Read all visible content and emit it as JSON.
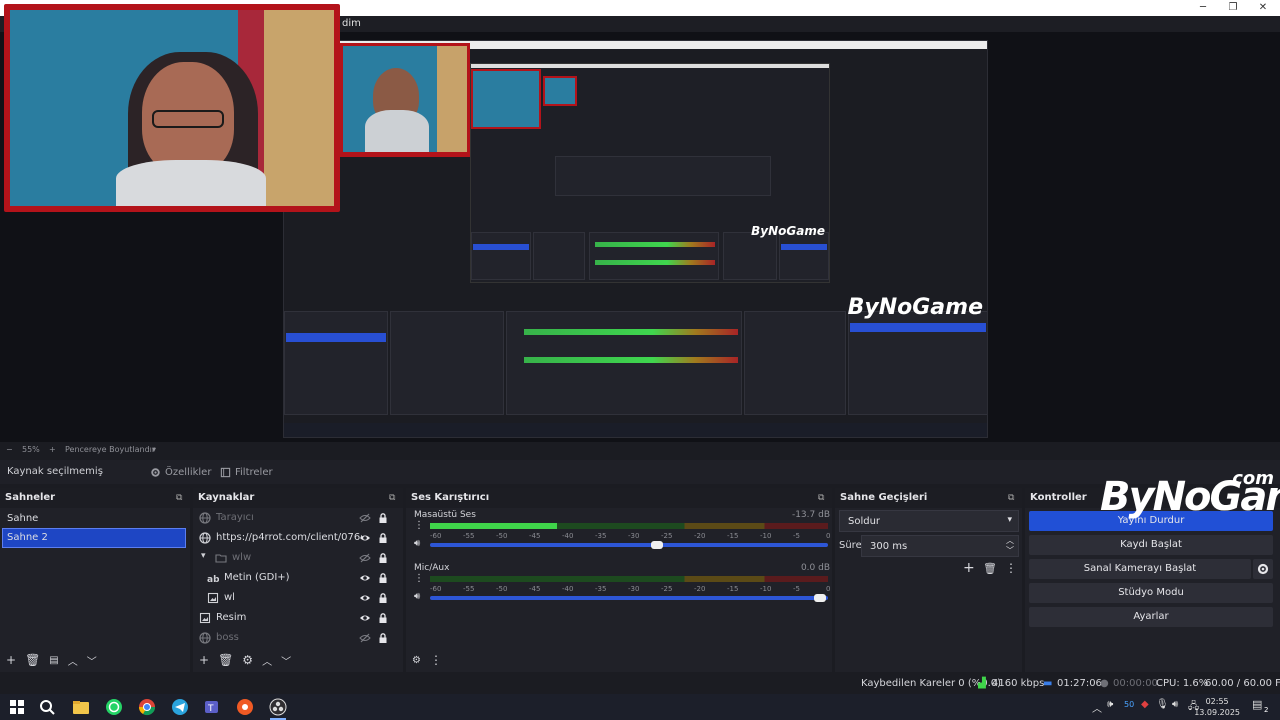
{
  "window": {
    "title_fragment": "dim"
  },
  "zoom": {
    "minus": "−",
    "level": "55%",
    "plus": "+",
    "fit": "Pencereye Boyutlandır"
  },
  "source_toolbar": {
    "no_source": "Kaynak seçilmemiş",
    "properties": "Özellikler",
    "filters": "Filtreler"
  },
  "scenes": {
    "title": "Sahneler",
    "items": [
      {
        "label": "Sahne",
        "selected": false
      },
      {
        "label": "Sahne 2",
        "selected": true
      }
    ]
  },
  "sources": {
    "title": "Kaynaklar",
    "items": [
      {
        "label": "Tarayıcı",
        "icon": "globe-icon",
        "visible": false,
        "dim": true,
        "indent": 0
      },
      {
        "label": "https://p4rrot.com/client/076e7cf1-",
        "icon": "globe-icon",
        "visible": true,
        "dim": false,
        "indent": 0
      },
      {
        "label": "wlw",
        "icon": "folder-icon",
        "visible": false,
        "dim": true,
        "indent": 1
      },
      {
        "label": "Metin (GDI+)",
        "icon": "text-icon",
        "visible": true,
        "dim": false,
        "indent": 2
      },
      {
        "label": "wl",
        "icon": "image-icon",
        "visible": true,
        "dim": false,
        "indent": 2
      },
      {
        "label": "Resim",
        "icon": "image-icon",
        "visible": true,
        "dim": false,
        "indent": 0
      },
      {
        "label": "boss",
        "icon": "globe-icon",
        "visible": false,
        "dim": true,
        "indent": 0
      }
    ]
  },
  "mixer": {
    "title": "Ses Karıştırıcı",
    "ticks": [
      "-60",
      "-55",
      "-50",
      "-45",
      "-40",
      "-35",
      "-30",
      "-25",
      "-20",
      "-15",
      "-10",
      "-5",
      "0"
    ],
    "channels": [
      {
        "name": "Masaüstü Ses",
        "db": "-13.7 dB",
        "level": 0.32,
        "volume": 0.57
      },
      {
        "name": "Mic/Aux",
        "db": "0.0 dB",
        "level": 0.0,
        "volume": 0.98
      }
    ]
  },
  "transitions": {
    "title": "Sahne Geçişleri",
    "selected": "Soldur",
    "duration_label": "Süre",
    "duration_value": "300 ms"
  },
  "controls": {
    "title": "Kontroller",
    "buttons": [
      "Yayını Durdur",
      "Kaydı Başlat",
      "Sanal Kamerayı Başlat",
      "Stüdyo Modu",
      "Ayarlar"
    ]
  },
  "status": {
    "dropped": "Kaybedilen Kareler 0 (%0.0)",
    "bitrate": "4160 kbps",
    "stream_time": "01:27:06",
    "rec_time": "00:00:00",
    "cpu": "CPU: 1.6%",
    "fps": "60.00 / 60.00 FPS"
  },
  "taskbar": {
    "time": "02:55",
    "date": "13.09.2025",
    "notifications": "2",
    "tray_number": "50"
  },
  "logo": {
    "main": "ByNoGame",
    "suffix": ".com"
  },
  "colors": {
    "accent": "#2150d6",
    "webcam_frame": "#b3131a",
    "meter_green": "#3fd44a",
    "meter_yellow": "#a07a1e",
    "meter_red": "#a82426"
  }
}
